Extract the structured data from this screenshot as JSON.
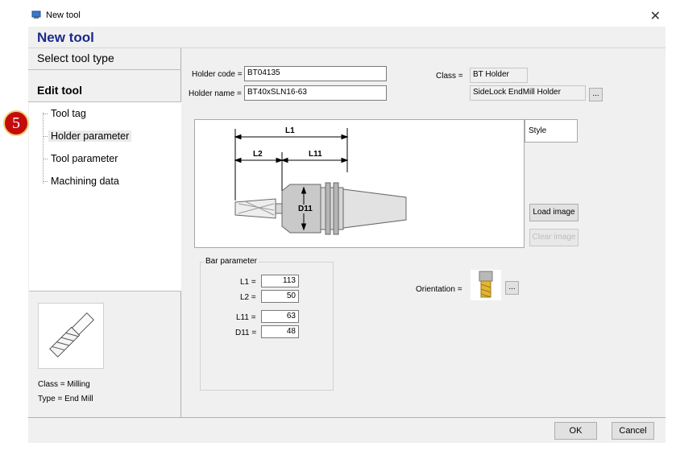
{
  "window": {
    "title": "New tool",
    "close_glyph": "✕"
  },
  "header": {
    "title": "New tool"
  },
  "nav": {
    "select_tool_type": "Select tool type",
    "edit_tool": "Edit tool",
    "tree": [
      {
        "label": "Tool tag",
        "selected": false
      },
      {
        "label": "Holder parameter",
        "selected": true
      },
      {
        "label": "Tool parameter",
        "selected": false
      },
      {
        "label": "Machining data",
        "selected": false
      }
    ],
    "step_badge": "5"
  },
  "tool_info": {
    "icon": "end-mill-icon",
    "class_text": "Class = Milling",
    "type_text": "Type = End Mill"
  },
  "form": {
    "holder_code_label": "Holder code =",
    "holder_code_value": "BT04135",
    "holder_name_label": "Holder name =",
    "holder_name_value": "BT40xSLN16-63",
    "class_label": "Class =",
    "class_value": "BT Holder",
    "subclass_value": "SideLock EndMill Holder",
    "browse_button": "...",
    "style_label": "Style",
    "load_image_button": "Load image",
    "clear_image_button": "Clear image"
  },
  "diagram": {
    "labels": {
      "l1": "L1",
      "l2": "L2",
      "l11": "L11",
      "d11": "D11"
    }
  },
  "bar_parameter": {
    "title": "Bar parameter",
    "rows": [
      {
        "label": "L1 =",
        "value": "113"
      },
      {
        "label": "L2 =",
        "value": "50"
      },
      {
        "label": "L11 =",
        "value": "63"
      },
      {
        "label": "D11 =",
        "value": "48"
      }
    ]
  },
  "orientation": {
    "label": "Orientation =",
    "icon": "end-mill-orientation-icon",
    "browse_button": "..."
  },
  "footer": {
    "ok": "OK",
    "cancel": "Cancel"
  },
  "colors": {
    "header_title": "#1b2a8a",
    "badge": "#c40c0c",
    "badge_ring": "#f1d070"
  }
}
